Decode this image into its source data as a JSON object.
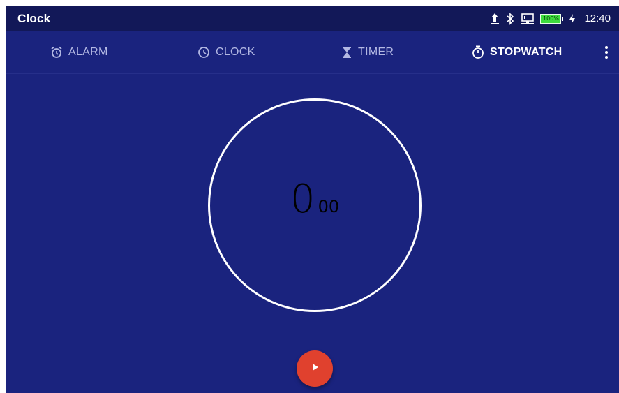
{
  "status_bar": {
    "app_title": "Clock",
    "battery_label": "100%",
    "time": "12:40",
    "icons": [
      "upload-icon",
      "bluetooth-icon",
      "network-icon",
      "battery-icon",
      "charging-icon"
    ]
  },
  "tabs": [
    {
      "label": "ALARM",
      "icon": "alarm-icon",
      "active": false
    },
    {
      "label": "CLOCK",
      "icon": "clock-icon",
      "active": false
    },
    {
      "label": "TIMER",
      "icon": "hourglass-icon",
      "active": false
    },
    {
      "label": "STOPWATCH",
      "icon": "stopwatch-icon",
      "active": true
    }
  ],
  "stopwatch": {
    "seconds": "0",
    "hundredths": "00"
  },
  "actions": {
    "start_icon": "play-icon"
  },
  "colors": {
    "background": "#1a237e",
    "status_bar": "#121858",
    "fab": "#e0412e",
    "battery": "#3ddc3d",
    "inactive_tab": "#b3b8e3"
  }
}
